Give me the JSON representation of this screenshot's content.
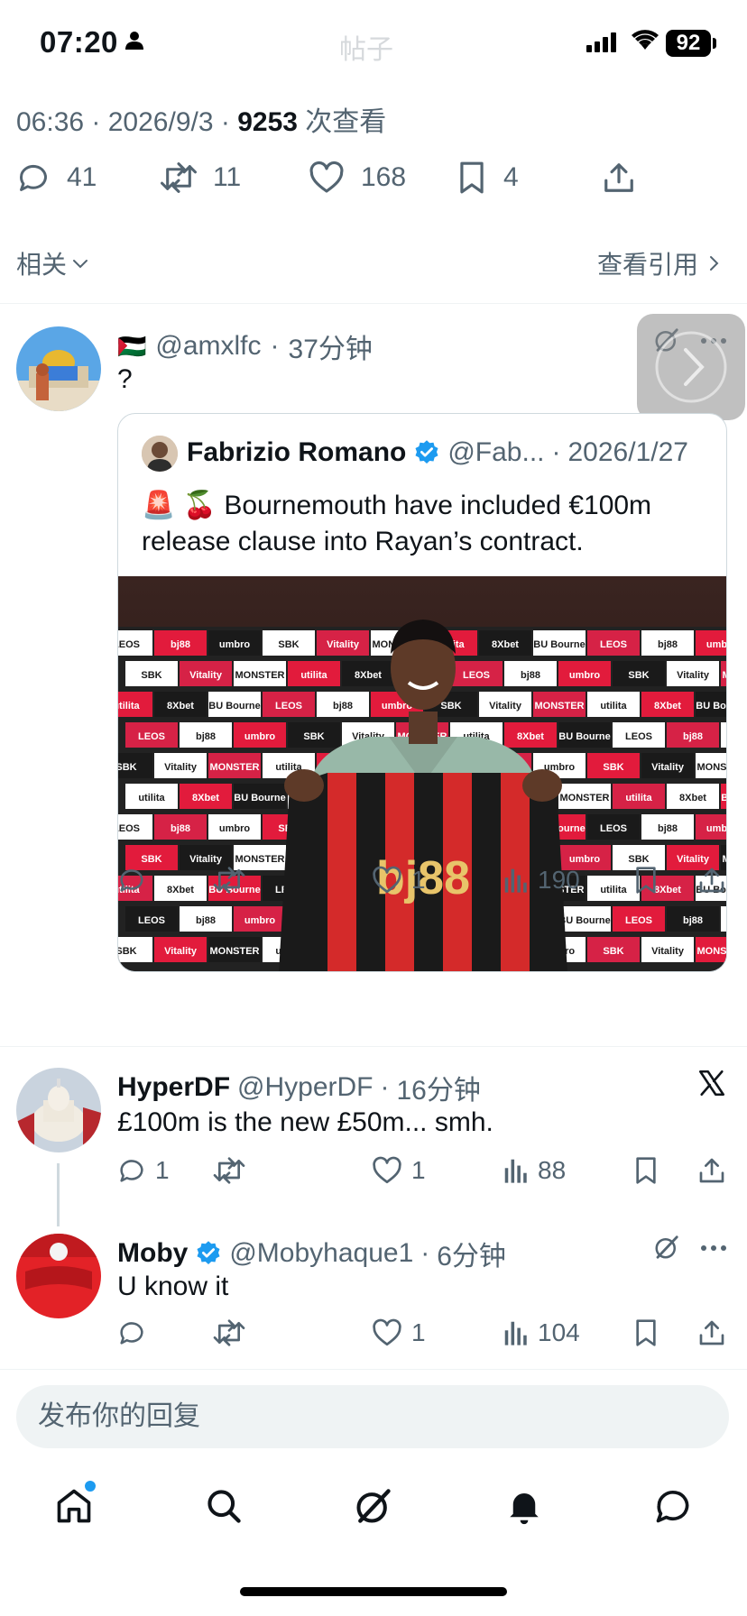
{
  "status_bar": {
    "time": "07:20",
    "battery": "92",
    "title": "帖子"
  },
  "tweet_meta": {
    "time": "06:36",
    "date": "2026/9/3",
    "views_count": "9253",
    "views_label": "次查看"
  },
  "stats": {
    "replies": "41",
    "retweets": "11",
    "likes": "168",
    "bookmarks": "4"
  },
  "relevance": {
    "label": "相关",
    "quotes_link": "查看引用"
  },
  "replies": [
    {
      "flag": "🇵🇸",
      "handle": "@amxlfc",
      "time": "37分钟",
      "text": "?",
      "quoted": {
        "name": "Fabrizio Romano",
        "handle": "@Fab...",
        "date": "2026/1/27",
        "emoji": "🚨 🍒",
        "text_line1": "Bournemouth have included €100m",
        "text_line2": "release clause into Rayan’s contract."
      },
      "actions": {
        "replies": "",
        "retweets": "",
        "likes": "1",
        "views": "190"
      }
    },
    {
      "name": "HyperDF",
      "handle": "@HyperDF",
      "time": "16分钟",
      "text": "£100m is the new £50m... smh.",
      "actions": {
        "replies": "1",
        "retweets": "",
        "likes": "1",
        "views": "88"
      }
    },
    {
      "name": "Moby",
      "handle": "@Mobyhaque1",
      "time": "6分钟",
      "text": "U know it",
      "actions": {
        "replies": "",
        "retweets": "",
        "likes": "1",
        "views": "104"
      }
    }
  ],
  "reply_input": {
    "placeholder": "发布你的回复"
  },
  "photo_text": {
    "shirt_sponsor": "bj88",
    "boards": [
      "LEOS",
      "bj88",
      "umbro",
      "SBK",
      "Vitality Health insurance",
      "MONSTER",
      "utilita",
      "8Xbet",
      "BU Bournemouth University"
    ]
  },
  "colors": {
    "accent": "#1d9bf0",
    "verified": "#1d9bf0",
    "muted_text": "#536471",
    "shirt_red": "#d42a2a",
    "shirt_black": "#1a1a1a"
  }
}
